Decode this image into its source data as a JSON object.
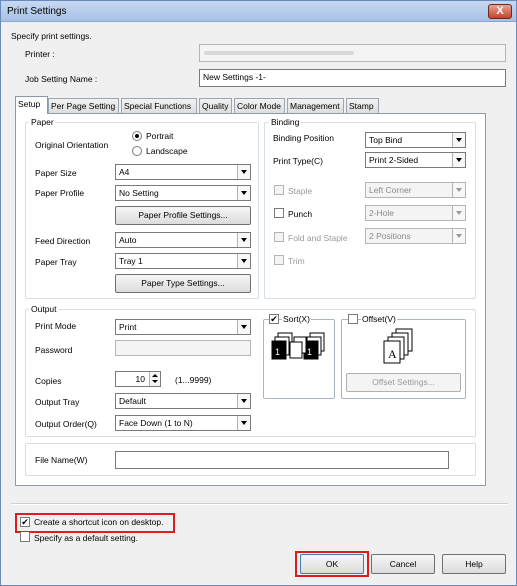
{
  "window": {
    "title": "Print Settings",
    "close_label": "X"
  },
  "header": {
    "intro": "Specify print settings.",
    "printer_label": "Printer :",
    "printer_value": "",
    "job_label": "Job Setting Name :",
    "job_value": "New Settings -1-"
  },
  "tabs": [
    {
      "label": "Setup",
      "active": true
    },
    {
      "label": "Per Page Setting"
    },
    {
      "label": "Special Functions"
    },
    {
      "label": "Quality"
    },
    {
      "label": "Color Mode"
    },
    {
      "label": "Management"
    },
    {
      "label": "Stamp"
    }
  ],
  "paper": {
    "group_title": "Paper",
    "orientation_label": "Original Orientation",
    "portrait": "Portrait",
    "landscape": "Landscape",
    "size_label": "Paper Size",
    "size_value": "A4",
    "profile_label": "Paper Profile",
    "profile_value": "No Setting",
    "profile_button": "Paper Profile Settings...",
    "feed_label": "Feed Direction",
    "feed_value": "Auto",
    "tray_label": "Paper Tray",
    "tray_value": "Tray 1",
    "type_button": "Paper Type Settings..."
  },
  "binding": {
    "group_title": "Binding",
    "position_label": "Binding Position",
    "position_value": "Top Bind",
    "print_type_label": "Print Type(C)",
    "print_type_value": "Print 2-Sided",
    "staple_label": "Staple",
    "staple_value": "Left Corner",
    "punch_label": "Punch",
    "punch_value": "2-Hole",
    "fold_label": "Fold and Staple",
    "fold_value": "2 Positions",
    "trim_label": "Trim"
  },
  "output": {
    "group_title": "Output",
    "mode_label": "Print Mode",
    "mode_value": "Print",
    "password_label": "Password",
    "password_value": "",
    "copies_label": "Copies",
    "copies_value": "10",
    "copies_range": "(1...9999)",
    "tray_label": "Output Tray",
    "tray_value": "Default",
    "order_label": "Output Order(Q)",
    "order_value": "Face Down (1 to N)",
    "sort_label": "Sort(X)",
    "sort_checked": true,
    "offset_label": "Offset(V)",
    "offset_checked": false,
    "offset_button": "Offset Settings..."
  },
  "file": {
    "label": "File Name(W)",
    "value": ""
  },
  "options": {
    "shortcut_label": "Create a shortcut icon on desktop.",
    "shortcut_checked": true,
    "default_label": "Specify as a default setting.",
    "default_checked": false
  },
  "footer": {
    "ok": "OK",
    "cancel": "Cancel",
    "help": "Help"
  },
  "colors": {
    "highlight": "#e01c1c",
    "title_bar": "#b9cfee"
  }
}
